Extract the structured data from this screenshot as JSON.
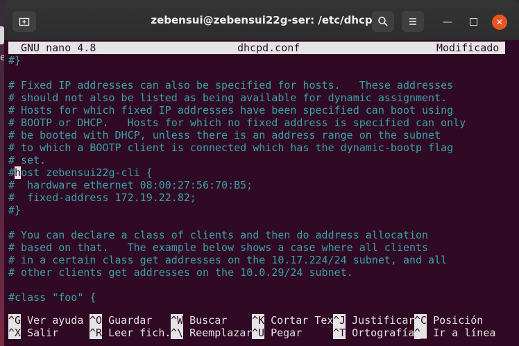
{
  "desktop": {
    "partial_text": "er"
  },
  "window": {
    "title": "zebensui@zebensui22g-ser: /etc/dhcp"
  },
  "nano": {
    "version": "GNU nano 4.8",
    "filename": "dhcpd.conf",
    "status": "Modificado"
  },
  "lines": [
    {
      "text": "#}",
      "kind": "cmt"
    },
    {
      "text": "",
      "kind": "cmt"
    },
    {
      "text": "# Fixed IP addresses can also be specified for hosts.   These addresses",
      "kind": "cmt"
    },
    {
      "text": "# should not also be listed as being available for dynamic assignment.",
      "kind": "cmt"
    },
    {
      "text": "# Hosts for which fixed IP addresses have been specified can boot using",
      "kind": "cmt"
    },
    {
      "text": "# BOOTP or DHCP.   Hosts for which no fixed address is specified can only",
      "kind": "cmt"
    },
    {
      "text": "# be booted with DHCP, unless there is an address range on the subnet",
      "kind": "cmt"
    },
    {
      "text": "# to which a BOOTP client is connected which has the dynamic-bootp flag",
      "kind": "cmt"
    },
    {
      "text": "# set.",
      "kind": "cmt"
    },
    {
      "text": "#host zebensui22g-cli {",
      "kind": "cursorline"
    },
    {
      "text": "#  hardware ethernet 08:00:27:56:70:B5;",
      "kind": "cmt"
    },
    {
      "text": "#  fixed-address 172.19.22.82;",
      "kind": "cmt"
    },
    {
      "text": "#}",
      "kind": "cmt"
    },
    {
      "text": "",
      "kind": "cmt"
    },
    {
      "text": "# You can declare a class of clients and then do address allocation",
      "kind": "cmt"
    },
    {
      "text": "# based on that.   The example below shows a case where all clients",
      "kind": "cmt"
    },
    {
      "text": "# in a certain class get addresses on the 10.17.224/24 subnet, and all",
      "kind": "cmt"
    },
    {
      "text": "# other clients get addresses on the 10.0.29/24 subnet.",
      "kind": "cmt"
    },
    {
      "text": "",
      "kind": "cmt"
    },
    {
      "text": "#class \"foo\" {",
      "kind": "cmt"
    }
  ],
  "cursor_line": {
    "before": "#",
    "char": "h",
    "after": "ost zebensui22g-cli {"
  },
  "shortcuts": {
    "row1": [
      {
        "key": "^G",
        "label": "Ver ayuda"
      },
      {
        "key": "^O",
        "label": "Guardar"
      },
      {
        "key": "^W",
        "label": "Buscar"
      },
      {
        "key": "^K",
        "label": "Cortar Tex"
      },
      {
        "key": "^J",
        "label": "Justificar"
      },
      {
        "key": "^C",
        "label": "Posición"
      }
    ],
    "row2": [
      {
        "key": "^X",
        "label": "Salir"
      },
      {
        "key": "^R",
        "label": "Leer fich."
      },
      {
        "key": "^\\",
        "label": "Reemplazar"
      },
      {
        "key": "^U",
        "label": "Pegar"
      },
      {
        "key": "^T",
        "label": "Ortografía"
      },
      {
        "key": "^_",
        "label": "Ir a línea"
      }
    ]
  },
  "colors": {
    "background": "#300a24",
    "comment": "#3aa0a8",
    "accent_close": "#e95420"
  }
}
